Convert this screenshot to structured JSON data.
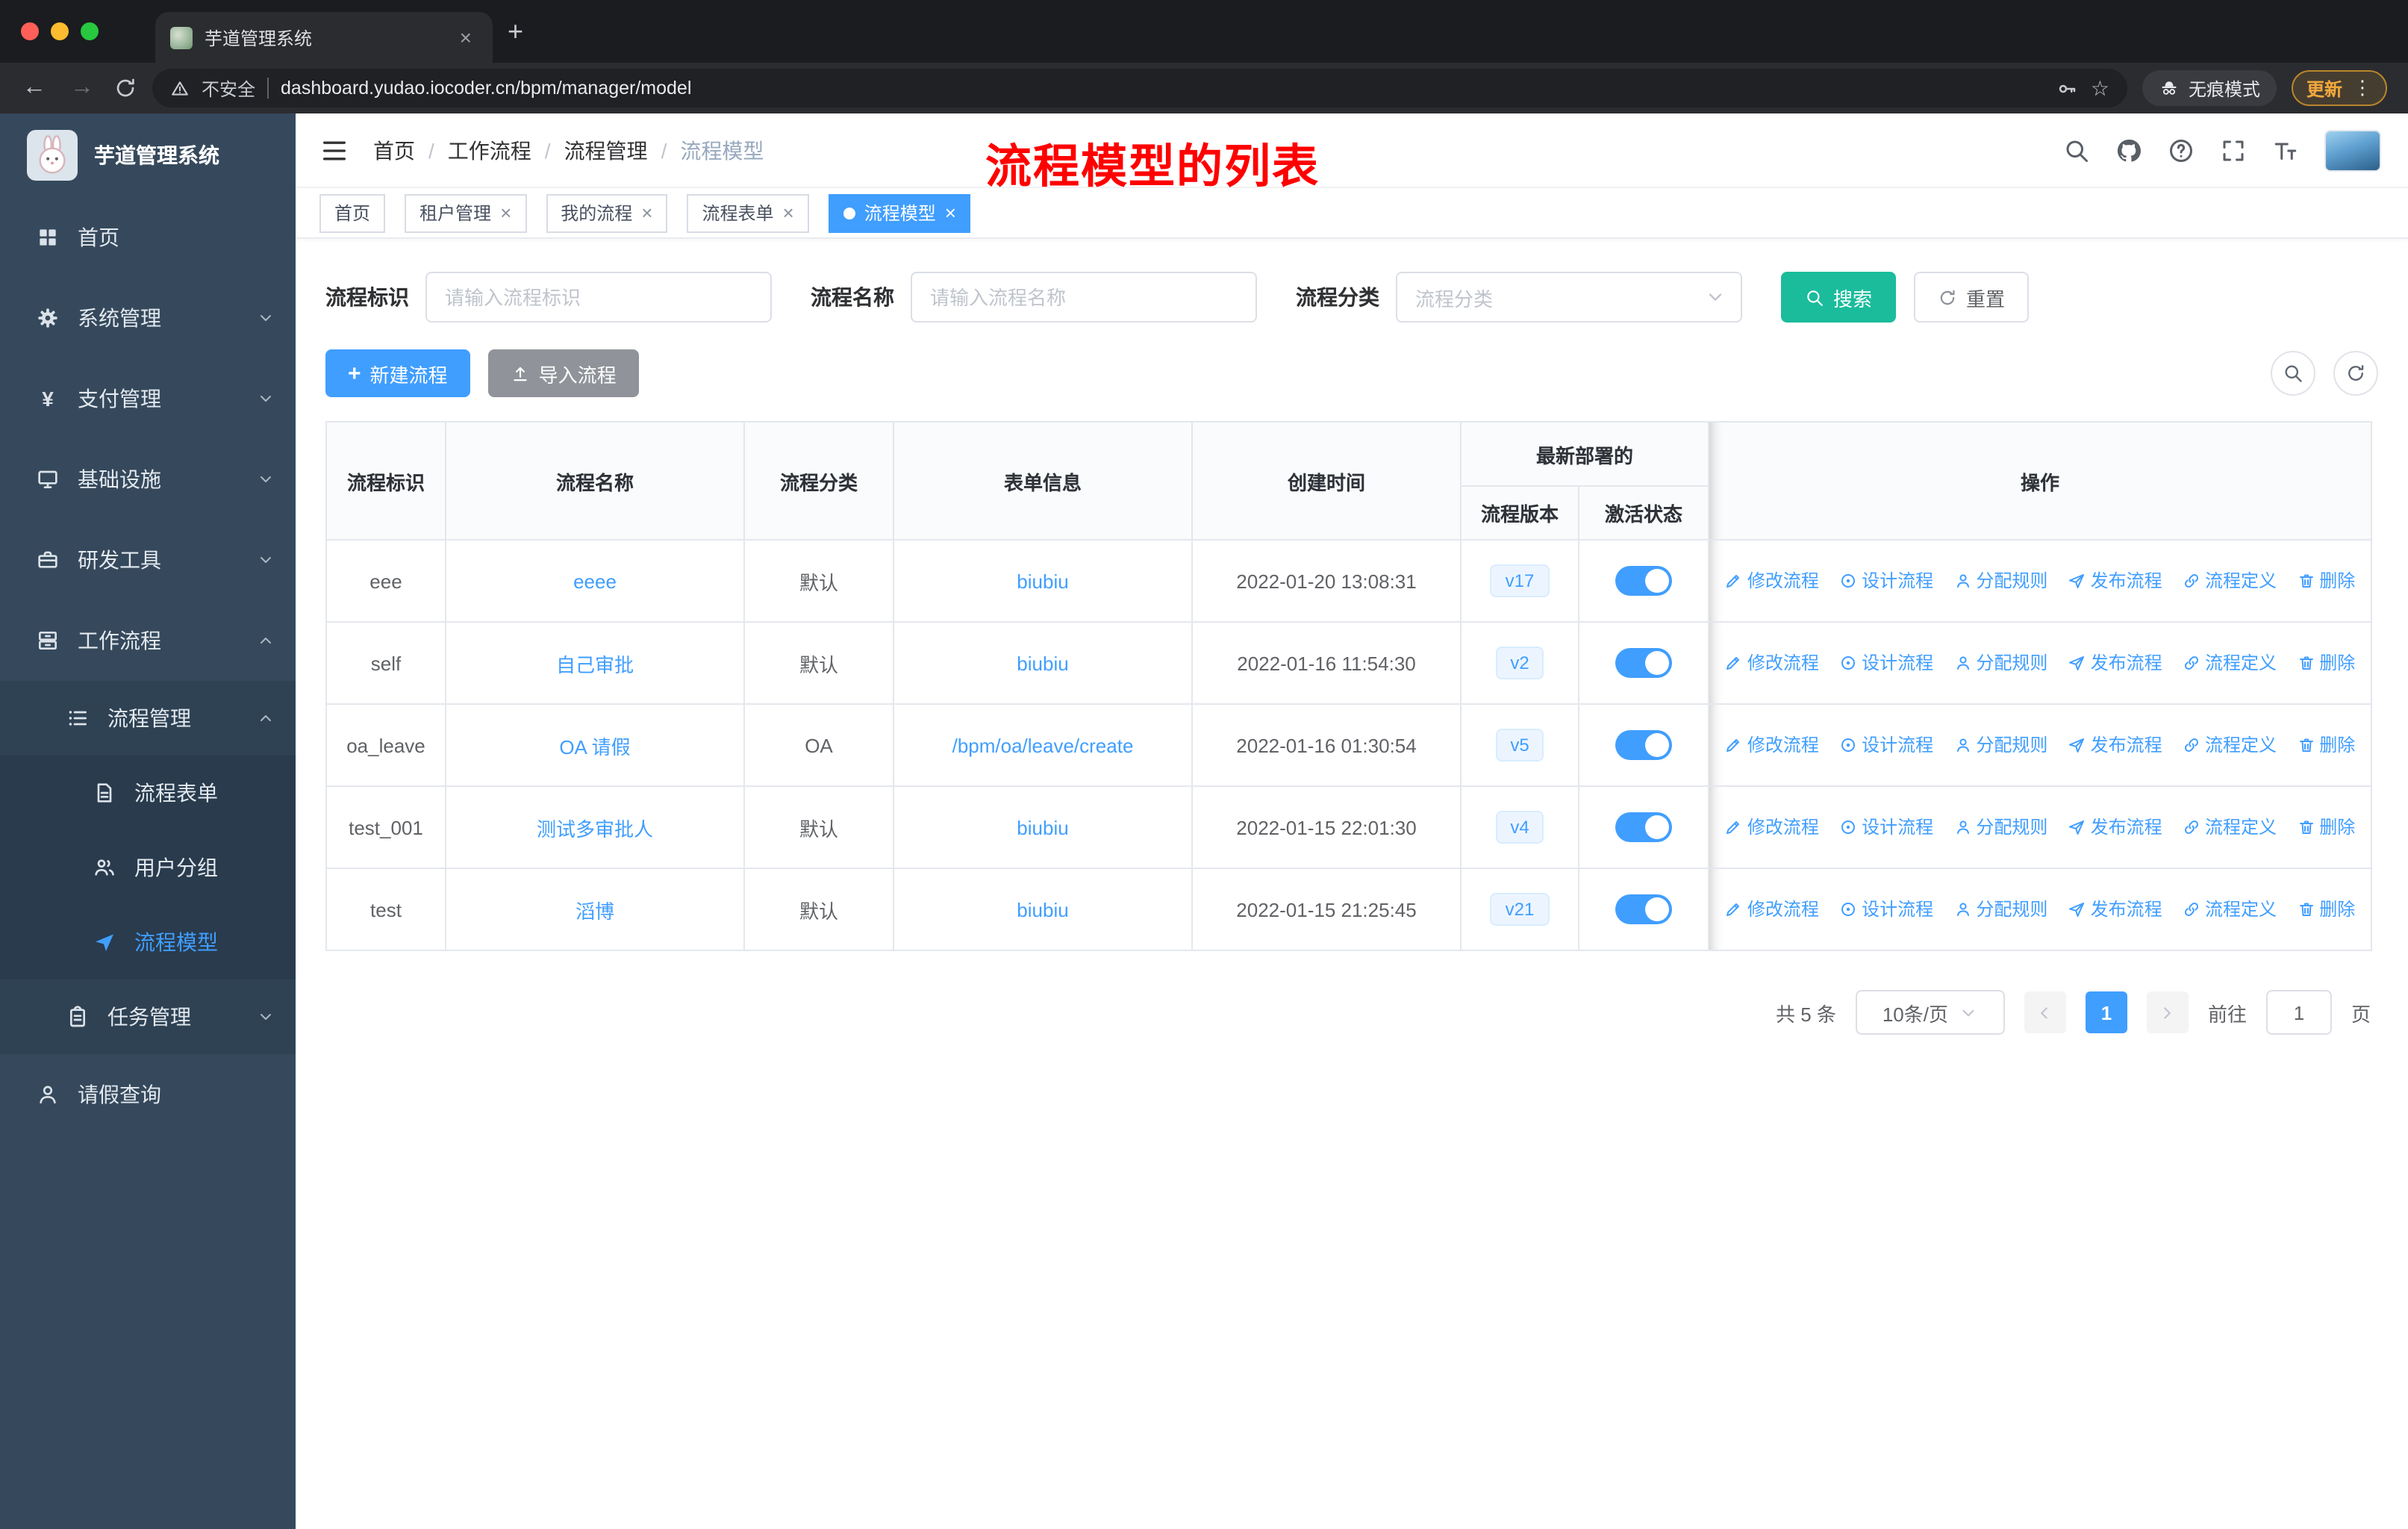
{
  "colors": {
    "accent": "#409EFF",
    "search_button": "#1ABC9C",
    "annotation_red": "#FF0000",
    "toggle_on": "#409EFF",
    "active_tag": "#409EFF"
  },
  "icons": {
    "close": "×",
    "more": "⋮",
    "back": "←",
    "forward": "→",
    "star": "☆",
    "plus": "+",
    "yen": "¥"
  },
  "browser": {
    "tab": {
      "title": "芋道管理系统"
    },
    "address": {
      "security_label": "不安全",
      "url": "dashboard.yudao.iocoder.cn/bpm/manager/model"
    },
    "incognito_label": "无痕模式",
    "update_button": "更新"
  },
  "sidebar": {
    "logo_title": "芋道管理系统",
    "items": [
      {
        "label": "首页",
        "icon": "dashboard-icon"
      },
      {
        "label": "系统管理",
        "icon": "gear-icon",
        "state": "collapsed"
      },
      {
        "label": "支付管理",
        "icon": "yen-icon",
        "state": "collapsed"
      },
      {
        "label": "基础设施",
        "icon": "monitor-icon",
        "state": "collapsed"
      },
      {
        "label": "研发工具",
        "icon": "toolbox-icon",
        "state": "collapsed"
      },
      {
        "label": "工作流程",
        "icon": "cabinet-icon",
        "state": "expanded"
      },
      {
        "label": "流程管理",
        "icon": "list-icon",
        "state": "expanded"
      },
      {
        "label": "流程表单",
        "icon": "document-icon"
      },
      {
        "label": "用户分组",
        "icon": "user-group-icon"
      },
      {
        "label": "流程模型",
        "icon": "paper-plane-icon",
        "active": true
      },
      {
        "label": "任务管理",
        "icon": "clipboard-icon",
        "state": "collapsed"
      },
      {
        "label": "请假查询",
        "icon": "user-icon"
      }
    ]
  },
  "navbar": {
    "breadcrumb": [
      "首页",
      "工作流程",
      "流程管理",
      "流程模型"
    ],
    "breadcrumb_separator": "/",
    "annotation": "流程模型的列表"
  },
  "tags": [
    {
      "label": "首页"
    },
    {
      "label": "租户管理",
      "closable": true
    },
    {
      "label": "我的流程",
      "closable": true
    },
    {
      "label": "流程表单",
      "closable": true
    },
    {
      "label": "流程模型",
      "closable": true,
      "active": true
    }
  ],
  "filters": {
    "fields": [
      {
        "label": "流程标识",
        "placeholder": "请输入流程标识",
        "type": "input"
      },
      {
        "label": "流程名称",
        "placeholder": "请输入流程名称",
        "type": "input"
      },
      {
        "label": "流程分类",
        "placeholder": "流程分类",
        "type": "select"
      }
    ],
    "search_button": "搜索",
    "reset_button": "重置"
  },
  "toolbar": {
    "create_button": "新建流程",
    "import_button": "导入流程"
  },
  "table": {
    "headers": {
      "id": "流程标识",
      "name": "流程名称",
      "category": "流程分类",
      "form": "表单信息",
      "created": "创建时间",
      "deploy_group": "最新部署的",
      "version": "流程版本",
      "status": "激活状态",
      "ops": "操作"
    },
    "ops": [
      {
        "label": "修改流程",
        "icon": "edit-icon"
      },
      {
        "label": "设计流程",
        "icon": "design-icon"
      },
      {
        "label": "分配规则",
        "icon": "assign-user-icon"
      },
      {
        "label": "发布流程",
        "icon": "publish-icon"
      },
      {
        "label": "流程定义",
        "icon": "definition-link-icon"
      },
      {
        "label": "删除",
        "icon": "trash-icon"
      }
    ],
    "rows": [
      {
        "id": "eee",
        "name": "eeee",
        "category": "默认",
        "form": "biubiu",
        "created": "2022-01-20 13:08:31",
        "version": "v17",
        "active": true
      },
      {
        "id": "self",
        "name": "自己审批",
        "category": "默认",
        "form": "biubiu",
        "created": "2022-01-16 11:54:30",
        "version": "v2",
        "active": true
      },
      {
        "id": "oa_leave",
        "name": "OA 请假",
        "category": "OA",
        "form": "/bpm/oa/leave/create",
        "created": "2022-01-16 01:30:54",
        "version": "v5",
        "active": true
      },
      {
        "id": "test_001",
        "name": "测试多审批人",
        "category": "默认",
        "form": "biubiu",
        "created": "2022-01-15 22:01:30",
        "version": "v4",
        "active": true
      },
      {
        "id": "test",
        "name": "滔博",
        "category": "默认",
        "form": "biubiu",
        "created": "2022-01-15 21:25:45",
        "version": "v21",
        "active": true
      }
    ]
  },
  "pagination": {
    "total_label": "共 5 条",
    "page_size": "10条/页",
    "current_page": "1",
    "goto_label": "前往",
    "goto_value": "1",
    "page_unit": "页"
  }
}
